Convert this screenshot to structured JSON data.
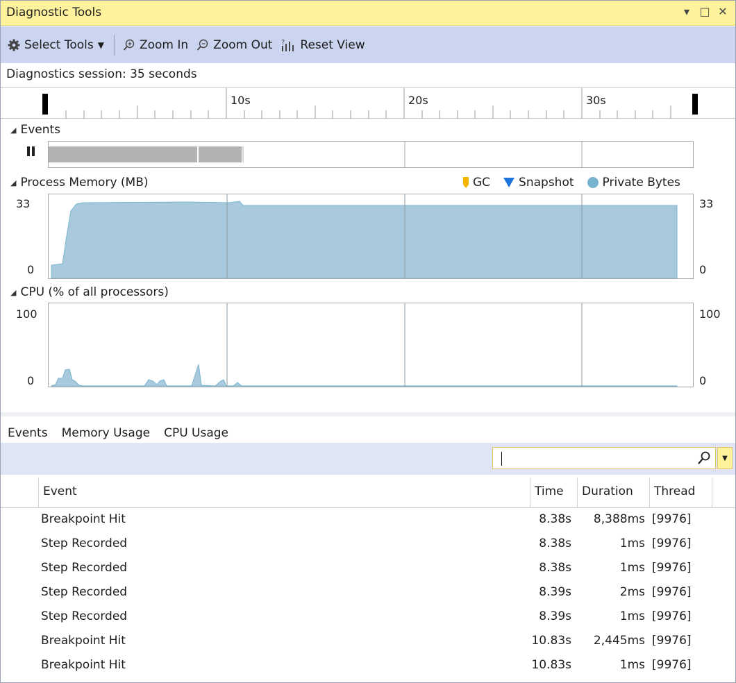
{
  "window": {
    "title": "Diagnostic Tools",
    "controls": {
      "dropdown": "▾",
      "maximize": "□",
      "close": "✕"
    }
  },
  "toolbar": {
    "select_tools": "Select Tools",
    "zoom_in": "Zoom In",
    "zoom_out": "Zoom Out",
    "reset_view": "Reset View"
  },
  "session": {
    "label": "Diagnostics session: 35 seconds"
  },
  "ruler": {
    "ticks": [
      "10s",
      "20s",
      "30s"
    ]
  },
  "events_section": {
    "label": "Events",
    "pause_icon": "pause-icon"
  },
  "memory_section": {
    "label": "Process Memory (MB)",
    "y_max": "33",
    "y_min": "0",
    "legend": {
      "gc": "GC",
      "snapshot": "Snapshot",
      "private_bytes": "Private Bytes"
    },
    "colors": {
      "gc": "#f5b400",
      "snapshot": "#1e74d8",
      "private_bytes": "#79b4cf"
    }
  },
  "cpu_section": {
    "label": "CPU (% of all processors)",
    "y_max": "100",
    "y_min": "0"
  },
  "tabs": [
    "Events",
    "Memory Usage",
    "CPU Usage"
  ],
  "table": {
    "headers": {
      "event": "Event",
      "time": "Time",
      "duration": "Duration",
      "thread": "Thread"
    },
    "rows": [
      {
        "event": "Breakpoint Hit",
        "time": "8.38s",
        "duration": "8,388ms",
        "thread": "[9976]"
      },
      {
        "event": "Step Recorded",
        "time": "8.38s",
        "duration": "1ms",
        "thread": "[9976]"
      },
      {
        "event": "Step Recorded",
        "time": "8.38s",
        "duration": "1ms",
        "thread": "[9976]"
      },
      {
        "event": "Step Recorded",
        "time": "8.39s",
        "duration": "2ms",
        "thread": "[9976]"
      },
      {
        "event": "Step Recorded",
        "time": "8.39s",
        "duration": "1ms",
        "thread": "[9976]"
      },
      {
        "event": "Breakpoint Hit",
        "time": "10.83s",
        "duration": "2,445ms",
        "thread": "[9976]"
      },
      {
        "event": "Breakpoint Hit",
        "time": "10.83s",
        "duration": "1ms",
        "thread": "[9976]"
      }
    ]
  }
}
